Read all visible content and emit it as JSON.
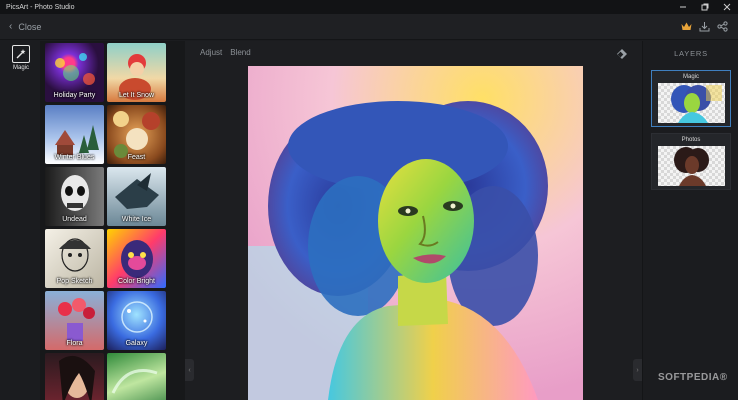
{
  "window": {
    "title": "PicsArt - Photo Studio",
    "controls": [
      "minimize-icon",
      "restore-icon",
      "close-icon"
    ]
  },
  "toolbar": {
    "close_label": "Close",
    "icons": [
      "crown-icon",
      "download-icon",
      "share-icon"
    ],
    "accent": "#e8a43a"
  },
  "tools": {
    "magic_label": "Magic"
  },
  "effects": [
    {
      "label": "Holiday Party"
    },
    {
      "label": "Let It Snow"
    },
    {
      "label": "Winter Blues"
    },
    {
      "label": "Feast"
    },
    {
      "label": "Undead"
    },
    {
      "label": "White Ice"
    },
    {
      "label": "Pop Sketch"
    },
    {
      "label": "Color Bright"
    },
    {
      "label": "Flora"
    },
    {
      "label": "Galaxy"
    },
    {
      "label": ""
    },
    {
      "label": ""
    }
  ],
  "canvas": {
    "tabs": [
      "Adjust",
      "Blend"
    ],
    "eraser_icon": "eraser-icon"
  },
  "layers": {
    "header": "LAYERS",
    "items": [
      {
        "label": "Magic",
        "active": true
      },
      {
        "label": "Photos",
        "active": false
      }
    ],
    "active_color": "#3f7fbf"
  },
  "watermark": "SOFTPEDIA®"
}
